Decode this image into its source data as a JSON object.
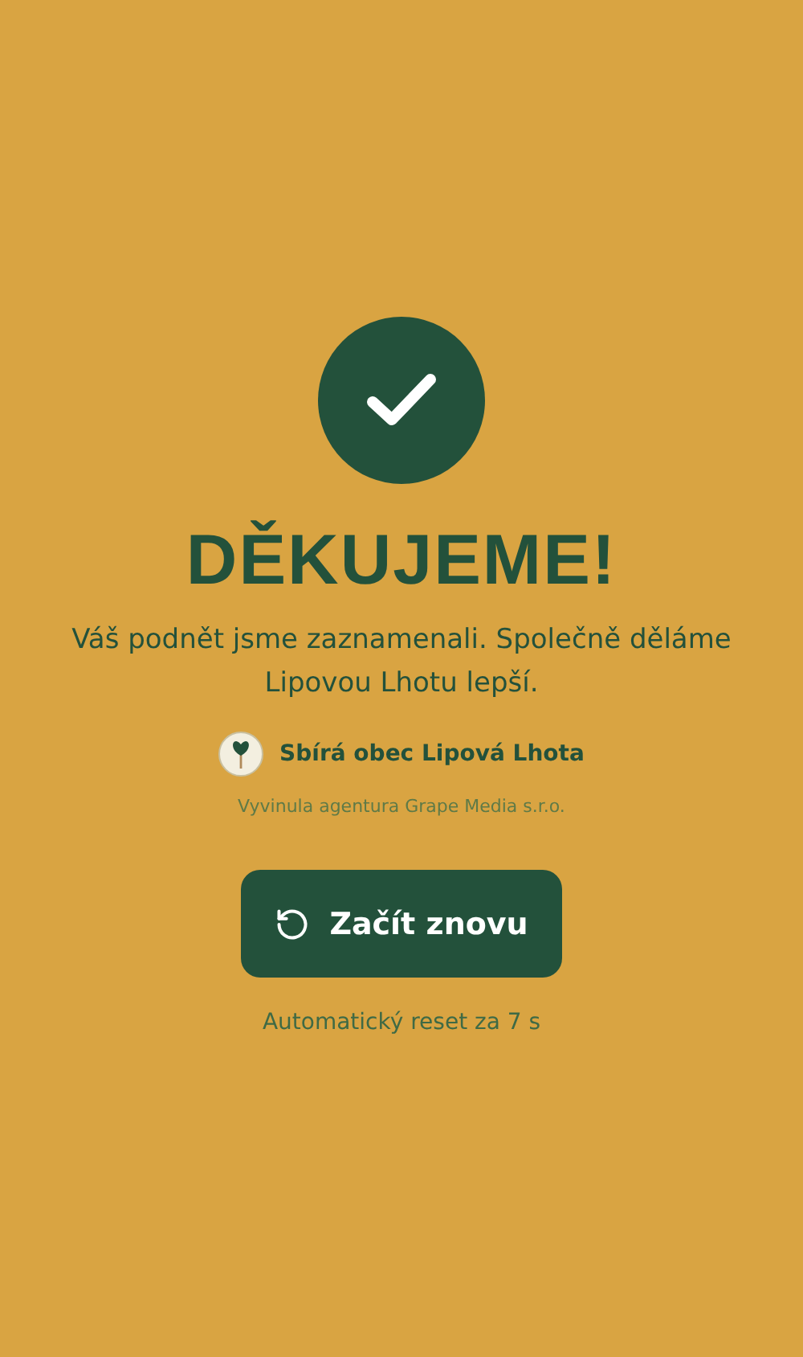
{
  "title": "DĚKUJEME!",
  "message": "Váš podnět jsme zaznamenali. Společně děláme Lipovou Lhotu lepší.",
  "collector": {
    "label": "Sbírá obec Lipová Lhota"
  },
  "credit": "Vyvinula agentura Grape Media s.r.o.",
  "button": {
    "label": "Začít znovu"
  },
  "countdown": "Automatický reset za 7 s"
}
